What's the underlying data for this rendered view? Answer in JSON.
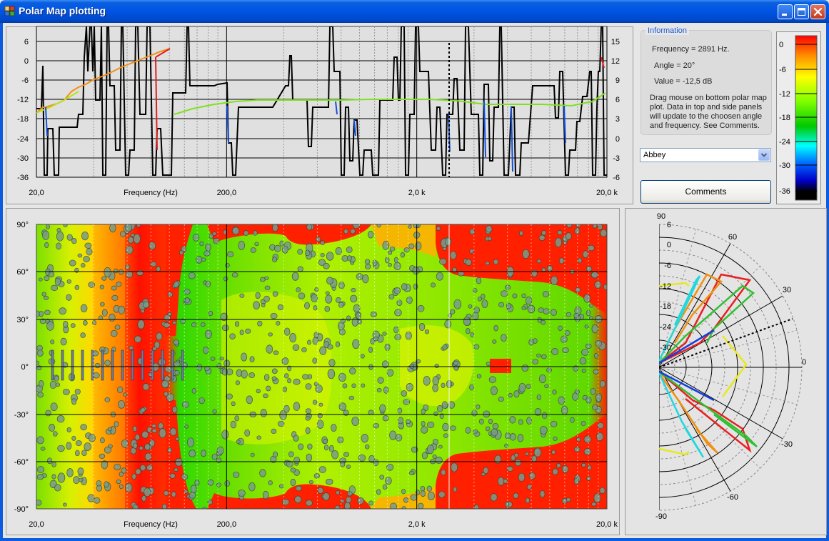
{
  "window": {
    "title": "Polar Map plotting",
    "colors": {
      "titlebar": "#0054e3",
      "client": "#e6e6e6"
    }
  },
  "info": {
    "legend": "Information",
    "frequency": "Frequency = 2891 Hz.",
    "angle": "Angle = 20°",
    "value": "Value = -12,5 dB",
    "help": [
      "Drag mouse on bottom polar map",
      "plot.  Data in top and side panels",
      "will update to the choosen angle",
      "and frequency.  See Comments."
    ]
  },
  "selector": {
    "selected": "Abbey"
  },
  "comments_button": {
    "label": "Comments"
  },
  "top_chart": {
    "x_ticks": [
      "20,0",
      "200,0",
      "2,0 k",
      "20,0 k"
    ],
    "x_label": "Frequency (Hz)",
    "y_left_ticks": [
      "6",
      "0",
      "-6",
      "-12",
      "-18",
      "-24",
      "-30",
      "-36"
    ],
    "y_right_ticks": [
      "15",
      "12",
      "9",
      "6",
      "3",
      "0",
      "-3",
      "-6"
    ]
  },
  "map_chart": {
    "x_ticks": [
      "20,0",
      "200,0",
      "2,0 k",
      "20,0 k"
    ],
    "x_label": "Frequency (Hz)",
    "y_ticks": [
      "90°",
      "60°",
      "30°",
      "0°",
      "-30°",
      "-60°",
      "-90°"
    ]
  },
  "polar_chart": {
    "angle_labels": [
      "90",
      "60",
      "30",
      "0",
      "-30",
      "-60",
      "-90"
    ],
    "radial_labels": [
      "6",
      "0",
      "-6",
      "-12",
      "-18",
      "-24",
      "-30"
    ]
  },
  "colorbar": {
    "labels": [
      "0",
      "-6",
      "-12",
      "-18",
      "-24",
      "-30",
      "-36"
    ],
    "stops": [
      "#ff0000",
      "#ff8c00",
      "#ffff00",
      "#7fff00",
      "#00c800",
      "#00ffff",
      "#0064ff",
      "#0000c8",
      "#000000"
    ]
  },
  "chart_data": [
    {
      "type": "line",
      "title": "",
      "xlabel": "Frequency (Hz)",
      "xscale": "log",
      "xlim": [
        20,
        20000
      ],
      "ylim": [
        -36,
        6
      ],
      "y2lim": [
        -6,
        15
      ],
      "grid": true,
      "series": [
        {
          "x": [
            20,
            30,
            50,
            100,
            200,
            500,
            1000,
            2000,
            5000,
            10000,
            20000
          ],
          "y": [
            -17,
            -15,
            -9,
            -9,
            -17,
            -15,
            -12,
            -12,
            -13,
            -13,
            -10
          ]
        }
      ],
      "cursor_x": 2891
    },
    {
      "type": "heatmap",
      "title": "",
      "xlabel": "Frequency (Hz)",
      "xscale": "log",
      "xlim": [
        20,
        20000
      ],
      "ylim": [
        -90,
        90
      ],
      "zlim": [
        -36,
        3
      ]
    },
    {
      "type": "line",
      "title": "",
      "polar": true,
      "theta_range": [
        -90,
        90
      ],
      "r_range": [
        -36,
        6
      ],
      "cursor_angle": 20
    }
  ]
}
